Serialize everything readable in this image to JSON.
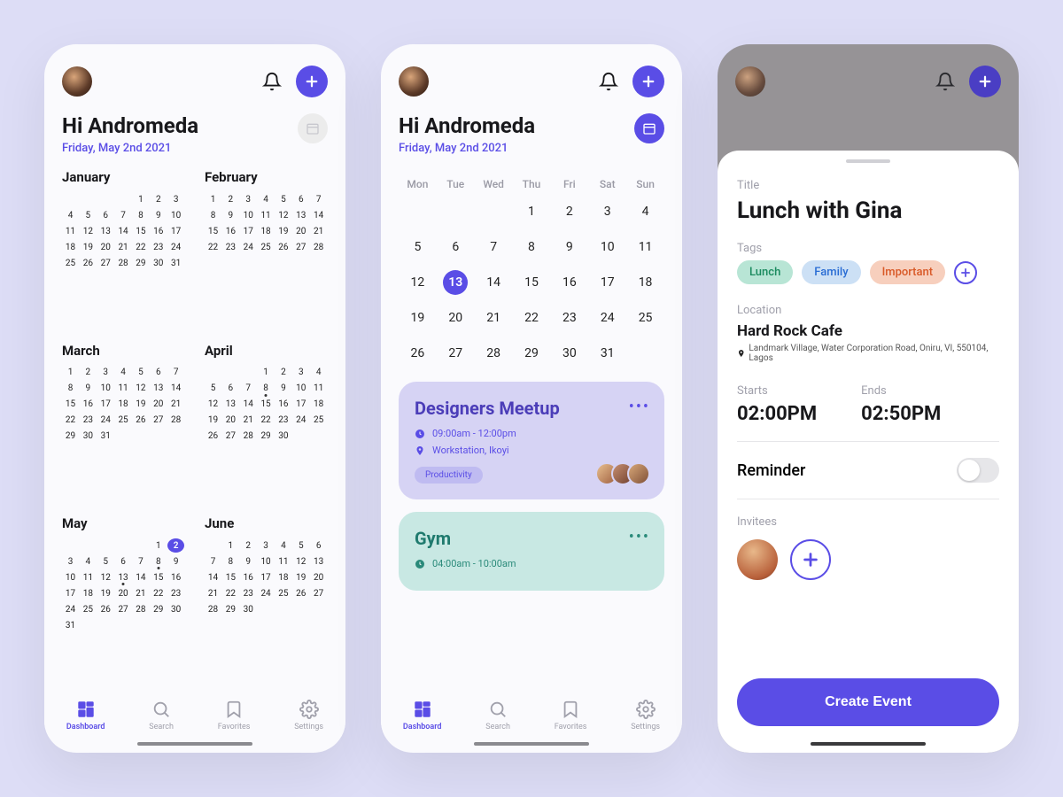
{
  "greeting": "Hi Andromeda",
  "date": "Friday, May 2nd 2021",
  "weekdays": [
    "Mon",
    "Tue",
    "Wed",
    "Thu",
    "Fri",
    "Sat",
    "Sun"
  ],
  "year_months": [
    {
      "name": "January",
      "offset": 4,
      "days": 31,
      "sel": null,
      "dots": []
    },
    {
      "name": "February",
      "offset": 0,
      "days": 28,
      "sel": null,
      "dots": []
    },
    {
      "name": "March",
      "offset": 0,
      "days": 31,
      "sel": null,
      "dots": []
    },
    {
      "name": "April",
      "offset": 3,
      "days": 30,
      "sel": null,
      "dots": [
        8
      ]
    },
    {
      "name": "May",
      "offset": 5,
      "days": 31,
      "sel": 2,
      "dots": [
        8,
        13
      ]
    },
    {
      "name": "June",
      "offset": 1,
      "days": 30,
      "sel": null,
      "dots": []
    }
  ],
  "week_selected": 13,
  "week_days": [
    [
      "",
      "",
      "",
      "1",
      "2",
      "3",
      "4"
    ],
    [
      "5",
      "6",
      "7",
      "8",
      "9",
      "10",
      "11"
    ],
    [
      "12",
      "13",
      "14",
      "15",
      "16",
      "17",
      "18"
    ],
    [
      "19",
      "20",
      "21",
      "22",
      "23",
      "24",
      "25"
    ],
    [
      "26",
      "27",
      "28",
      "29",
      "30",
      "31",
      ""
    ]
  ],
  "events": [
    {
      "title": "Designers Meetup",
      "time": "09:00am - 12:00pm",
      "location": "Workstation, Ikoyi",
      "tag": "Productivity"
    },
    {
      "title": "Gym",
      "time": "04:00am - 10:00am"
    }
  ],
  "nav": {
    "dashboard": "Dashboard",
    "search": "Search",
    "favorites": "Favorites",
    "settings": "Settings"
  },
  "sheet": {
    "title_label": "Title",
    "title": "Lunch with Gina",
    "tags_label": "Tags",
    "tags": {
      "lunch": "Lunch",
      "family": "Family",
      "important": "Important"
    },
    "location_label": "Location",
    "location_name": "Hard Rock Cafe",
    "location_addr": "Landmark Village, Water Corporation Road, Oniru, VI, 550104, Lagos",
    "starts_label": "Starts",
    "starts": "02:00PM",
    "ends_label": "Ends",
    "ends": "02:50PM",
    "reminder": "Reminder",
    "invitees_label": "Invitees",
    "create": "Create Event"
  }
}
